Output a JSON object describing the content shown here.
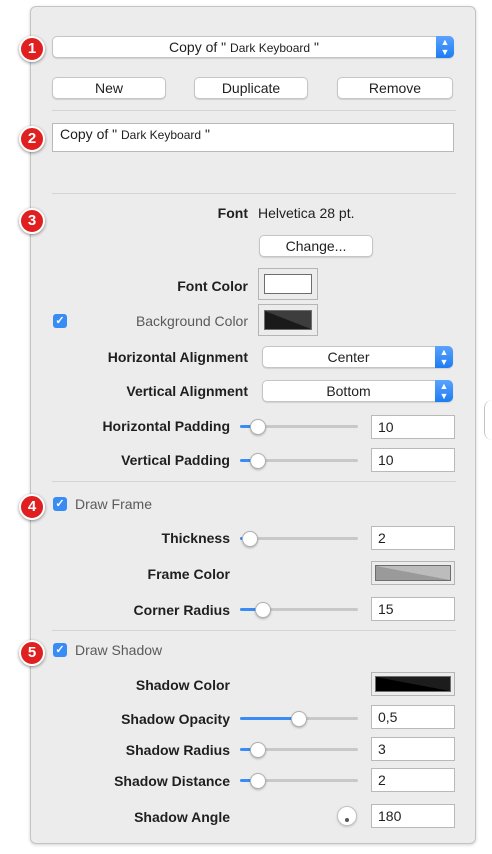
{
  "preset": {
    "popup_prefix": "Copy of \"",
    "popup_name": "Dark Keyboard",
    "popup_suffix": "\"",
    "new_label": "New",
    "duplicate_label": "Duplicate",
    "remove_label": "Remove",
    "name_value_prefix": "Copy of \"",
    "name_value_name": "Dark Keyboard",
    "name_value_suffix": "\""
  },
  "badges": [
    "1",
    "2",
    "3",
    "4",
    "5"
  ],
  "style": {
    "font_label": "Font",
    "font_value": "Helvetica 28 pt.",
    "change_label": "Change...",
    "font_color_label": "Font Color",
    "font_color": "#ffffff",
    "background_color_label": "Background Color",
    "background_enabled": true,
    "background_color": "#2b2b2b",
    "h_align_label": "Horizontal Alignment",
    "h_align_value": "Center",
    "v_align_label": "Vertical Alignment",
    "v_align_value": "Bottom",
    "h_padding_label": "Horizontal Padding",
    "h_padding_value": "10",
    "h_padding_level": 0.1,
    "v_padding_label": "Vertical Padding",
    "v_padding_value": "10",
    "v_padding_level": 0.1
  },
  "frame": {
    "draw_frame_label": "Draw Frame",
    "draw_frame_enabled": true,
    "thickness_label": "Thickness",
    "thickness_value": "2",
    "thickness_level": 0.02,
    "frame_color_label": "Frame Color",
    "frame_color": "#a9a9a9",
    "corner_radius_label": "Corner Radius",
    "corner_radius_value": "15",
    "corner_radius_level": 0.15
  },
  "shadow": {
    "draw_shadow_label": "Draw Shadow",
    "draw_shadow_enabled": true,
    "shadow_color_label": "Shadow Color",
    "shadow_color": "#000000",
    "shadow_opacity_label": "Shadow Opacity",
    "shadow_opacity_value": "0,5",
    "shadow_opacity_level": 0.5,
    "shadow_radius_label": "Shadow Radius",
    "shadow_radius_value": "3",
    "shadow_radius_level": 0.1,
    "shadow_distance_label": "Shadow Distance",
    "shadow_distance_value": "2",
    "shadow_distance_level": 0.1,
    "shadow_angle_label": "Shadow Angle",
    "shadow_angle_value": "180"
  }
}
